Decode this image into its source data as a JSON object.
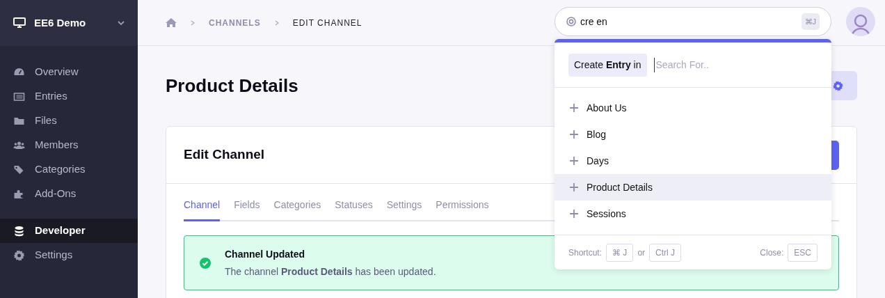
{
  "sidebar": {
    "site": "EE6 Demo",
    "groups": [
      {
        "items": [
          {
            "label": "Overview",
            "selected": false
          },
          {
            "label": "Entries",
            "selected": false
          },
          {
            "label": "Files",
            "selected": false
          },
          {
            "label": "Members",
            "selected": false
          },
          {
            "label": "Categories",
            "selected": false
          },
          {
            "label": "Add-Ons",
            "selected": false
          }
        ]
      },
      {
        "items": [
          {
            "label": "Developer",
            "selected": true
          },
          {
            "label": "Settings",
            "selected": false
          }
        ]
      }
    ]
  },
  "breadcrumb": [
    "CHANNELS",
    "EDIT CHANNEL"
  ],
  "search": {
    "value": "cre en",
    "shortcut": "⌘J"
  },
  "page_title": "Product Details",
  "card": {
    "title": "Edit Channel",
    "tabs": [
      {
        "label": "Channel",
        "selected": true
      },
      {
        "label": "Fields",
        "selected": false
      },
      {
        "label": "Categories",
        "selected": false
      },
      {
        "label": "Statuses",
        "selected": false
      },
      {
        "label": "Settings",
        "selected": false
      },
      {
        "label": "Permissions",
        "selected": false
      }
    ],
    "alert": {
      "title": "Channel Updated",
      "message": "The channel **Product Details** has been updated."
    }
  },
  "jump_menu": {
    "command": "Create **Entry** in",
    "placeholder": "Search For..",
    "items": [
      {
        "label": "About Us",
        "selected": false
      },
      {
        "label": "Blog",
        "selected": false
      },
      {
        "label": "Days",
        "selected": false
      },
      {
        "label": "Product Details",
        "selected": true
      },
      {
        "label": "Sessions",
        "selected": false
      }
    ],
    "shortcut_label": "Shortcut:",
    "shortcut_keys": [
      "⌘ J",
      "Ctrl J"
    ],
    "or": "or",
    "close_label": "Close:",
    "close_key": "ESC"
  }
}
